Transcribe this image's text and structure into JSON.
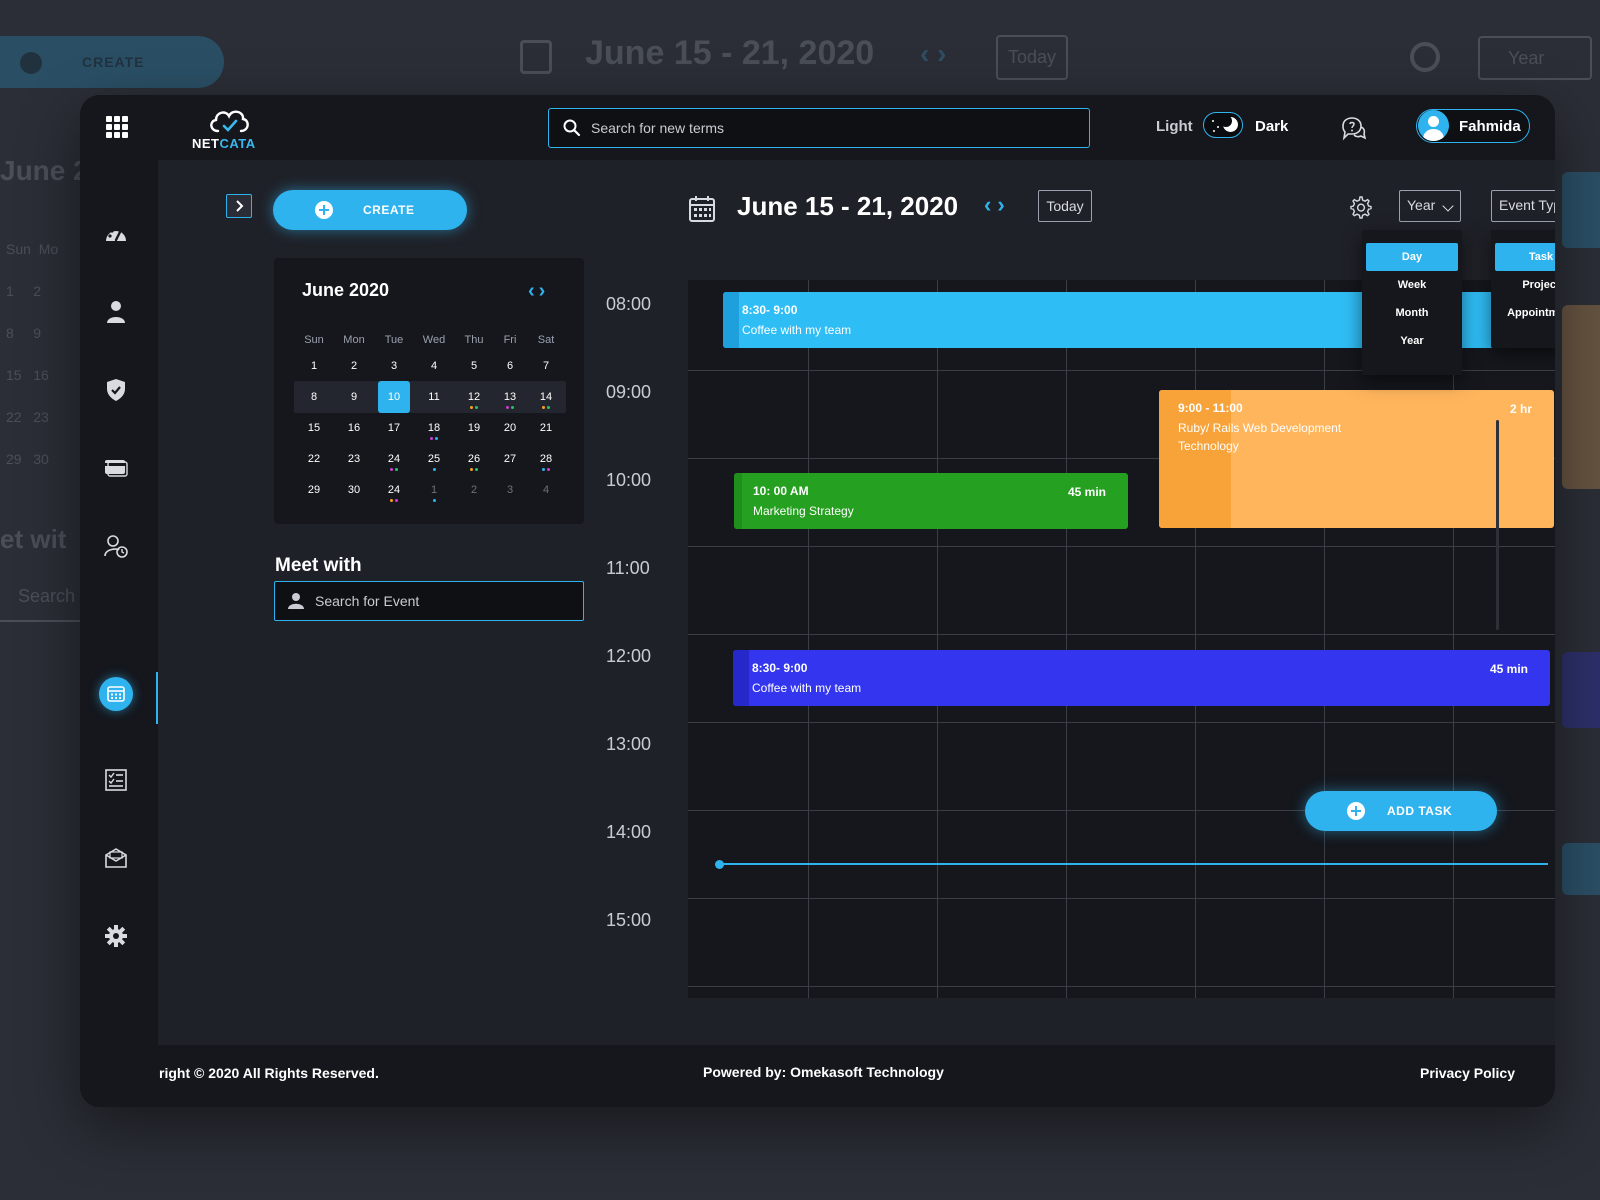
{
  "header": {
    "logo_prefix": "NET",
    "logo_suffix": "CATA",
    "search_placeholder": "Search for new terms",
    "mode_light": "Light",
    "mode_dark": "Dark",
    "user_name": "Fahmida"
  },
  "sidebar": {
    "items": [
      "dashboard-icon",
      "user-icon",
      "shield-icon",
      "card-icon",
      "user-clock-icon",
      "calendar-icon",
      "checklist-icon",
      "mail-icon",
      "gear-icon"
    ],
    "active": "calendar-icon"
  },
  "left_panel": {
    "create_label": "CREATE",
    "mini_calendar": {
      "title": "June 2020",
      "days_of_week": [
        "Sun",
        "Mon",
        "Tue",
        "Wed",
        "Thu",
        "Fri",
        "Sat"
      ],
      "weeks": [
        [
          "1",
          "2",
          "3",
          "4",
          "5",
          "6",
          "7"
        ],
        [
          "8",
          "9",
          "10",
          "11",
          "12",
          "13",
          "14"
        ],
        [
          "15",
          "16",
          "17",
          "18",
          "19",
          "20",
          "21"
        ],
        [
          "22",
          "23",
          "24",
          "25",
          "26",
          "27",
          "28"
        ],
        [
          "29",
          "30",
          "24",
          "1",
          "2",
          "3",
          "4"
        ]
      ],
      "selected": "10"
    },
    "meet_title": "Meet with",
    "meet_placeholder": "Search for Event"
  },
  "toolbar": {
    "range_title": "June 15 - 21, 2020",
    "today_label": "Today",
    "view_select": "Year",
    "type_select": "Event Type"
  },
  "view_options": [
    "Day",
    "Week",
    "Month",
    "Year"
  ],
  "view_selected": "Day",
  "type_options": [
    "Task",
    "Project",
    "Appointment"
  ],
  "type_selected": "Task",
  "time_labels": [
    "08:00",
    "09:00",
    "10:00",
    "11:00",
    "12:00",
    "13:00",
    "14:00",
    "15:00"
  ],
  "events": [
    {
      "time": "8:30- 9:00",
      "title": "Coffee with my team",
      "duration": "",
      "color": "#2fbdf5"
    },
    {
      "time": "9:00 - 11:00",
      "title": "Ruby/ Rails Web Development Technology",
      "duration": "2 hr",
      "color": "#ffb55c"
    },
    {
      "time": "10: 00 AM",
      "title": "Marketing Strategy",
      "duration": "45 min",
      "color": "#25a020"
    },
    {
      "time": "8:30- 9:00",
      "title": "Coffee with my team",
      "duration": "45 min",
      "color": "#3436ef"
    }
  ],
  "add_task_label": "ADD TASK",
  "footer": {
    "copyright": "right © 2020 All Rights Reserved.",
    "powered": "Powered by: Omekasoft Technology",
    "policy": "Privacy Policy"
  },
  "background_echo": {
    "create": "CREATE",
    "title": "June 15 - 21, 2020",
    "today": "Today",
    "year": "Year",
    "june": "June 2",
    "meet": "et wit",
    "search": "Search"
  },
  "colors": {
    "accent": "#2fb3ee",
    "panel": "#1f2128",
    "surface": "#15171d"
  }
}
